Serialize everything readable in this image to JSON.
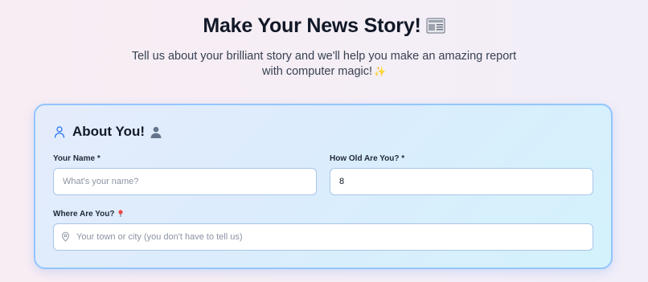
{
  "header": {
    "title": "Make Your News Story!",
    "title_emoji": "newspaper-icon",
    "subtitle": "Tell us about your brilliant story and we'll help you make an amazing report with computer magic!",
    "subtitle_emoji": "✨"
  },
  "about_section": {
    "title": "About You!",
    "title_icon": "person-outline-icon",
    "title_emoji": "bust-in-silhouette-icon",
    "name_field": {
      "label": "Your Name *",
      "placeholder": "What's your name?",
      "value": ""
    },
    "age_field": {
      "label": "How Old Are You? *",
      "placeholder": "",
      "value": "8"
    },
    "location_field": {
      "label": "Where Are You?",
      "label_emoji": "round-pushpin-icon",
      "icon": "map-pin-icon",
      "placeholder": "Your town or city (you don't have to tell us)",
      "value": ""
    }
  },
  "colors": {
    "card_border": "#93c5fd",
    "accent_icon": "#3b82f6",
    "title_text": "#111827"
  }
}
